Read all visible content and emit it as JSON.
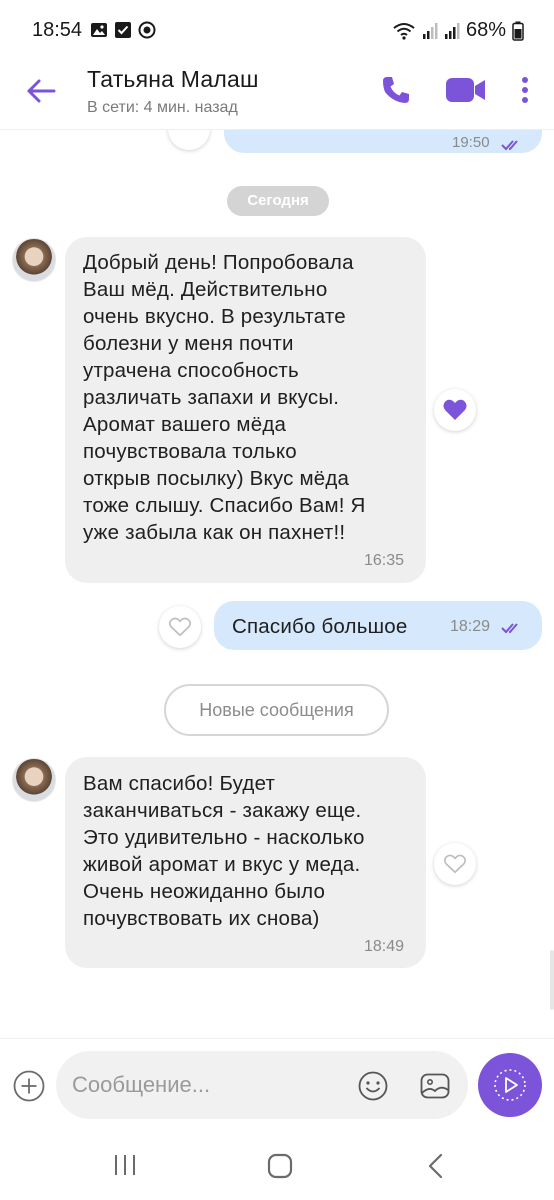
{
  "status_bar": {
    "time": "18:54",
    "battery": "68%",
    "icons": [
      "image-icon",
      "checkbox-icon",
      "app-icon",
      "wifi-icon",
      "signal-icon",
      "signal-icon",
      "battery-icon"
    ]
  },
  "header": {
    "contact_name": "Татьяна Малаш",
    "contact_status": "В сети: 4 мин. назад",
    "icons": [
      "back-arrow-icon",
      "phone-icon",
      "video-camera-icon",
      "more-vertical-icon"
    ],
    "accent_color": "#7b54d9"
  },
  "chat": {
    "previous_time": "19:50",
    "date_separator": "Сегодня",
    "messages": [
      {
        "direction": "incoming",
        "text_lines": [
          "Добрый день! Попробовала",
          "Ваш мёд. Действительно",
          "очень вкусно. В результате",
          "болезни у меня почти",
          "утрачена способность",
          "различать запахи и вкусы.",
          "Аромат вашего мёда",
          "почувствовала только",
          "открыв посылку) Вкус мёда",
          "тоже слышу. Спасибо Вам! Я",
          "уже забыла как он пахнет!!"
        ],
        "time": "16:35",
        "liked": true
      },
      {
        "direction": "outgoing",
        "text": "Спасибо большое",
        "time": "18:29",
        "read": true,
        "liked": false
      },
      {
        "direction": "incoming",
        "text_lines": [
          "Вам спасибо! Будет",
          "заканчиваться - закажу еще.",
          "Это удивительно - насколько",
          "живой аромат и вкус у меда.",
          "Очень неожиданно было",
          "почувствовать их снова)"
        ],
        "time": "18:49",
        "liked": false
      }
    ],
    "new_messages_label": "Новые сообщения",
    "colors": {
      "outgoing_bubble": "#d6e8fb",
      "incoming_bubble": "#efefef",
      "heart_filled": "#7b54d9"
    }
  },
  "composer": {
    "placeholder": "Сообщение...",
    "icons": [
      "plus-icon",
      "sticker-icon",
      "gallery-icon",
      "send-icon"
    ]
  },
  "nav_bar": {
    "icons": [
      "recent-apps-icon",
      "home-icon",
      "back-icon"
    ]
  }
}
